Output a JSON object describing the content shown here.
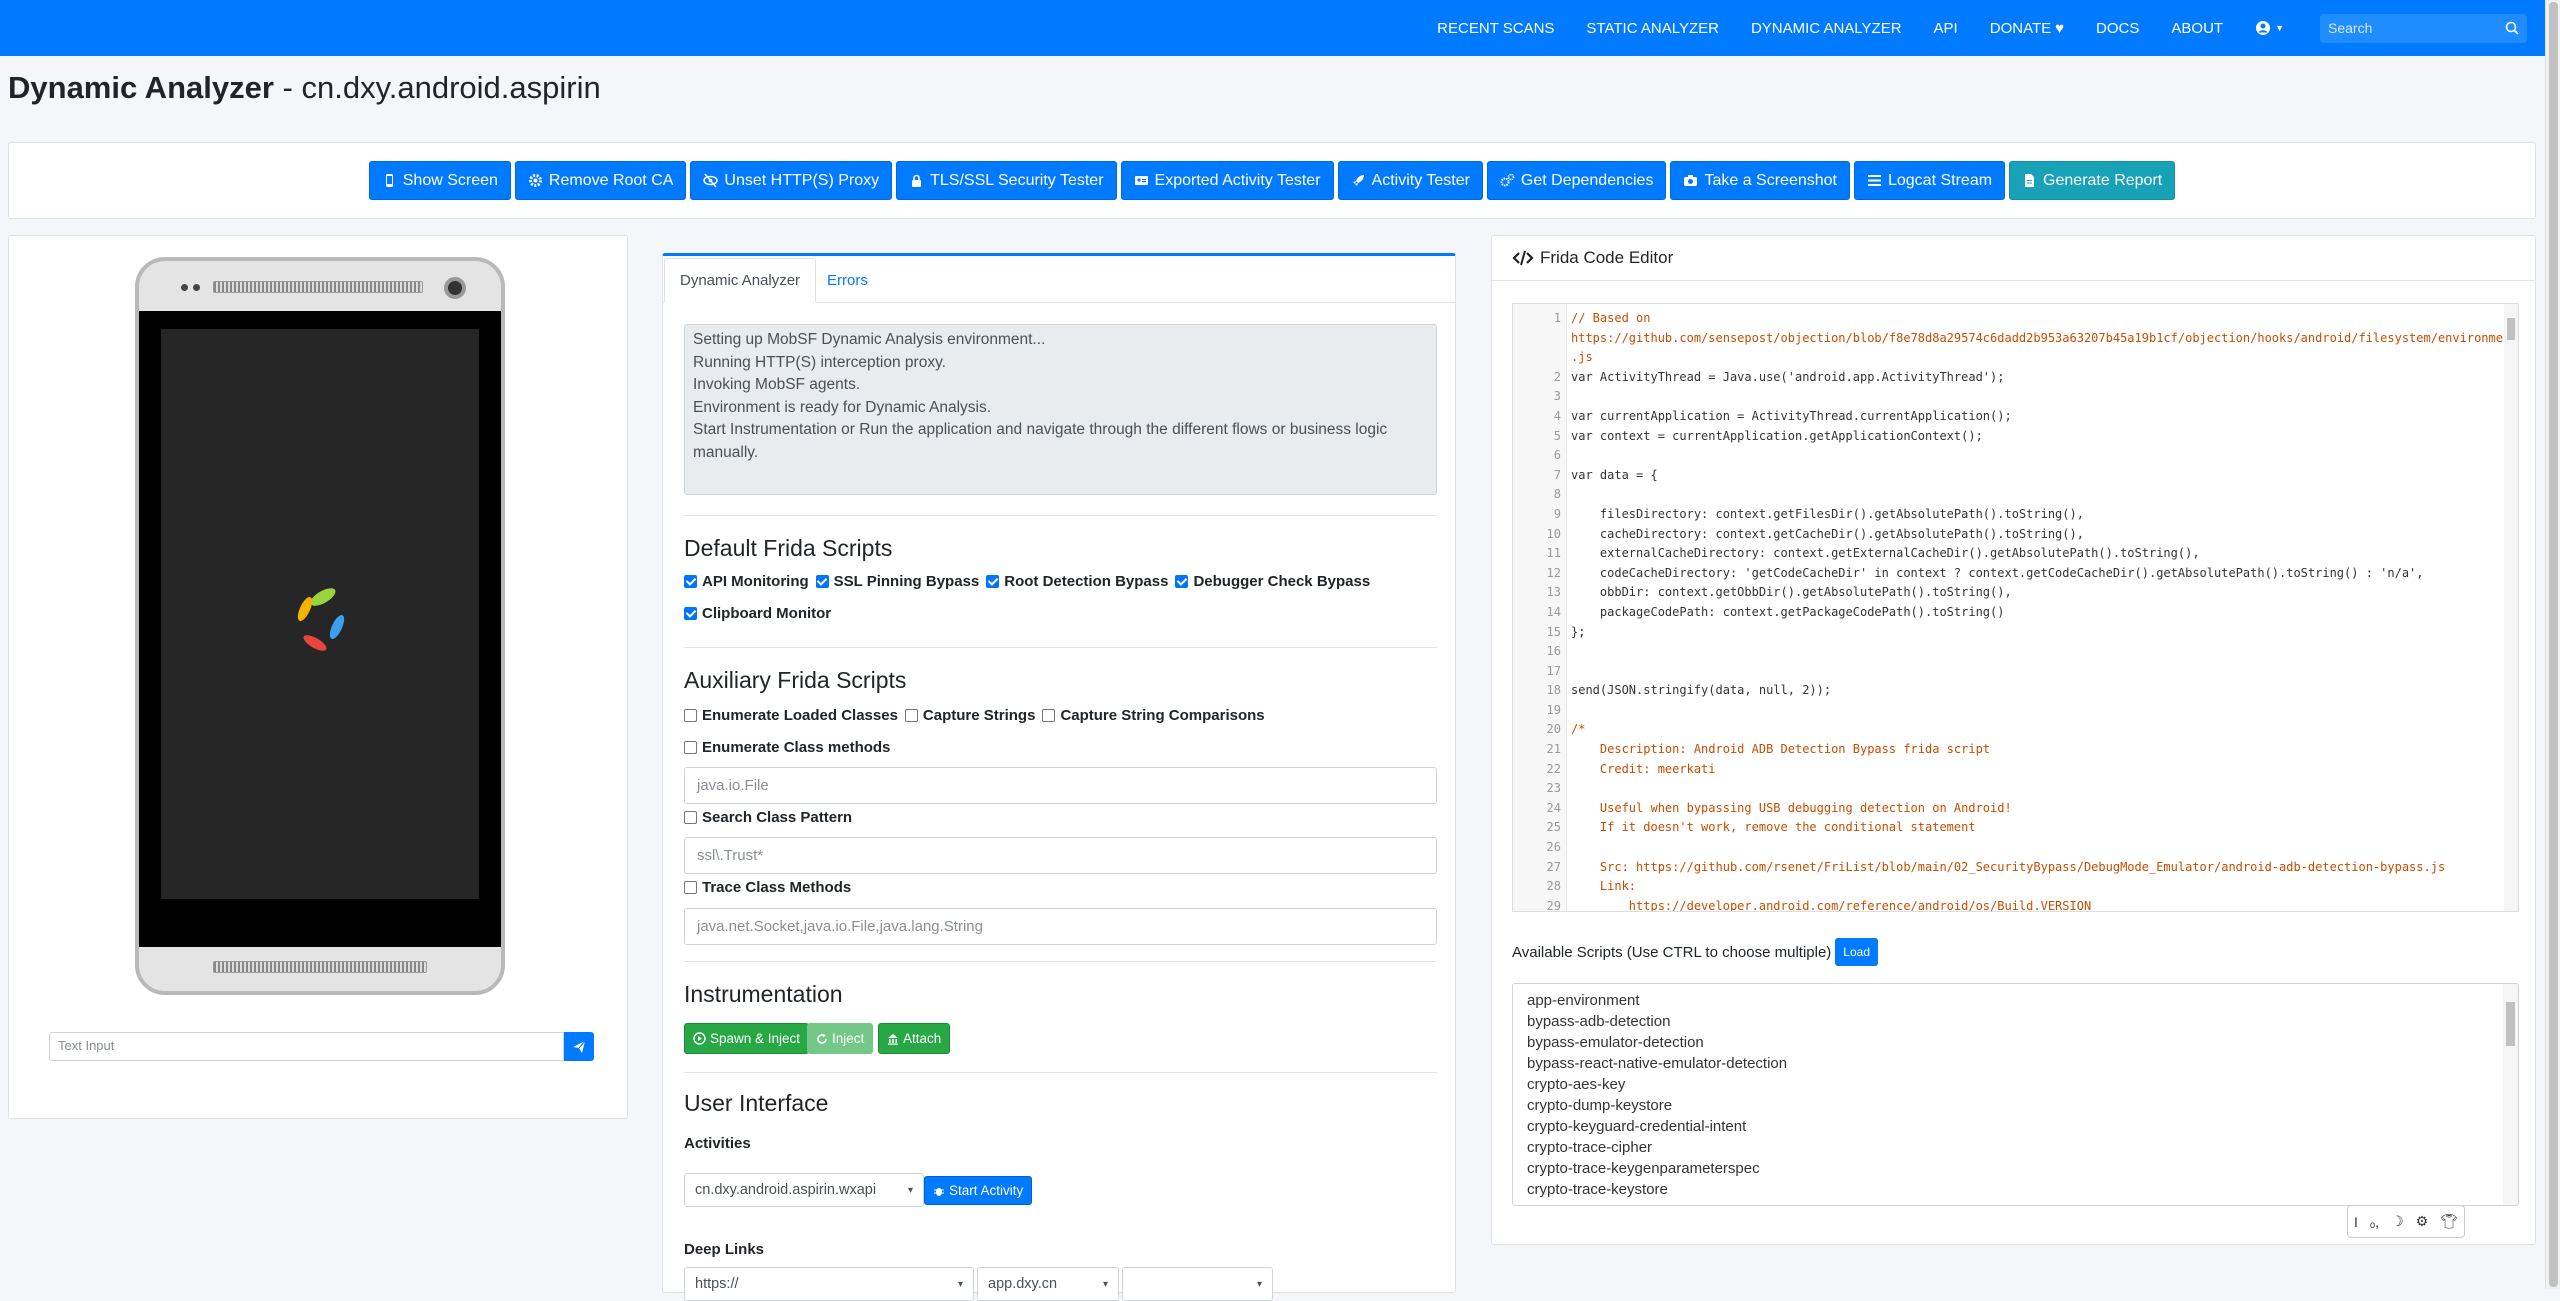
{
  "nav": {
    "items": [
      "RECENT SCANS",
      "STATIC ANALYZER",
      "DYNAMIC ANALYZER",
      "API",
      "DONATE",
      "DOCS",
      "ABOUT"
    ],
    "search_placeholder": "Search"
  },
  "page": {
    "title_bold": "Dynamic Analyzer",
    "title_rest": " - cn.dxy.android.aspirin"
  },
  "actions": {
    "buttons": [
      "Show Screen",
      "Remove Root CA",
      "Unset HTTP(S) Proxy",
      "TLS/SSL Security Tester",
      "Exported Activity Tester",
      "Activity Tester",
      "Get Dependencies",
      "Take a Screenshot",
      "Logcat Stream",
      "Generate Report"
    ]
  },
  "device": {
    "text_input_placeholder": "Text Input"
  },
  "middle": {
    "tabs": [
      "Dynamic Analyzer",
      "Errors"
    ],
    "log_lines": [
      "Setting up MobSF Dynamic Analysis environment...",
      "Running HTTP(S) interception proxy.",
      "Invoking MobSF agents.",
      "Environment is ready for Dynamic Analysis.",
      "Start Instrumentation or Run the application and navigate through the different flows or business logic manually."
    ],
    "default_scripts_title": "Default Frida Scripts",
    "default_scripts": [
      "API Monitoring",
      "SSL Pinning Bypass",
      "Root Detection Bypass",
      "Debugger Check Bypass",
      "Clipboard Monitor"
    ],
    "aux_title": "Auxiliary Frida Scripts",
    "aux_row1": [
      "Enumerate Loaded Classes",
      "Capture Strings",
      "Capture String Comparisons"
    ],
    "enum_methods_label": "Enumerate Class methods",
    "enum_methods_placeholder": "java.io.File",
    "search_pattern_label": "Search Class Pattern",
    "search_pattern_placeholder": "ssl\\.Trust*",
    "trace_label": "Trace Class Methods",
    "trace_placeholder": "java.net.Socket,java.io.File,java.lang.String",
    "instrumentation_title": "Instrumentation",
    "instr_buttons": [
      "Spawn & Inject",
      "Inject",
      "Attach"
    ],
    "ui_title": "User Interface",
    "activities_label": "Activities",
    "activity_selected": "cn.dxy.android.aspirin.wxapi",
    "start_activity": "Start Activity",
    "deeplinks_label": "Deep Links",
    "deeplink_selects": [
      "https://",
      "app.dxy.cn",
      ""
    ]
  },
  "right": {
    "header": "Frida Code Editor",
    "code_lines": [
      "// Based on",
      "https://github.com/sensepost/objection/blob/f8e78d8a29574c6dadd2b953a63207b45a19b1cf/objection/hooks/android/filesystem/environment",
      ".js",
      "var ActivityThread = Java.use('android.app.ActivityThread');",
      "",
      "var currentApplication = ActivityThread.currentApplication();",
      "var context = currentApplication.getApplicationContext();",
      "",
      "var data = {",
      "",
      "    filesDirectory: context.getFilesDir().getAbsolutePath().toString(),",
      "    cacheDirectory: context.getCacheDir().getAbsolutePath().toString(),",
      "    externalCacheDirectory: context.getExternalCacheDir().getAbsolutePath().toString(),",
      "    codeCacheDirectory: 'getCodeCacheDir' in context ? context.getCodeCacheDir().getAbsolutePath().toString() : 'n/a',",
      "    obbDir: context.getObbDir().getAbsolutePath().toString(),",
      "    packageCodePath: context.getPackageCodePath().toString()",
      "};",
      "",
      "",
      "send(JSON.stringify(data, null, 2));",
      "",
      "/*",
      "    Description: Android ADB Detection Bypass frida script",
      "    Credit: meerkati",
      "",
      "    Useful when bypassing USB debugging detection on Android!",
      "    If it doesn't work, remove the conditional statement",
      "",
      "    Src: https://github.com/rsenet/FriList/blob/main/02_SecurityBypass/DebugMode_Emulator/android-adb-detection-bypass.js",
      "    Link:",
      "        https://developer.android.com/reference/android/os/Build.VERSION"
    ],
    "line_numbers": [
      "1",
      "",
      "",
      "2",
      "3",
      "4",
      "5",
      "6",
      "7",
      "8",
      "9",
      "10",
      "11",
      "12",
      "13",
      "14",
      "15",
      "16",
      "17",
      "18",
      "19",
      "20",
      "21",
      "22",
      "23",
      "24",
      "25",
      "26",
      "27",
      "28",
      "29"
    ],
    "available_label": "Available Scripts (Use CTRL to choose multiple)",
    "load_label": "Load",
    "scripts": [
      "app-environment",
      "bypass-adb-detection",
      "bypass-emulator-detection",
      "bypass-react-native-emulator-detection",
      "crypto-aes-key",
      "crypto-dump-keystore",
      "crypto-keyguard-credential-intent",
      "crypto-trace-cipher",
      "crypto-trace-keygenparameterspec",
      "crypto-trace-keystore"
    ]
  },
  "colors": {
    "primary": "#007bff",
    "success": "#28a745",
    "info": "#17a2b8"
  }
}
